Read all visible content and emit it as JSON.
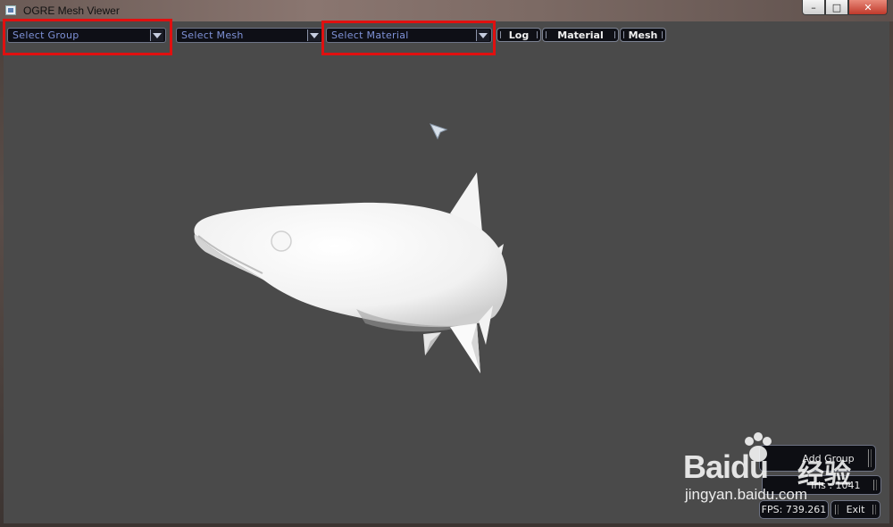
{
  "window": {
    "title": "OGRE Mesh Viewer",
    "controls": {
      "minimize": "–",
      "maximize": "□",
      "close": "✕"
    }
  },
  "toolbar": {
    "group_select": {
      "placeholder": "Select Group"
    },
    "mesh_select": {
      "placeholder": "Select Mesh"
    },
    "material_select": {
      "placeholder": "Select Material"
    },
    "tabs": [
      {
        "label": "Log"
      },
      {
        "label": "Material"
      },
      {
        "label": "Mesh"
      }
    ]
  },
  "panel": {
    "add_group_label": "Add Group",
    "tris_text": "Tris : 1041",
    "fps_text": "FPS: 739.261",
    "exit_label": "Exit"
  },
  "watermark": {
    "logo_text": "Baidu",
    "cn_text": "经验",
    "url_text": "jingyan.baidu.com"
  },
  "colors": {
    "highlight": "#e01010",
    "viewport_bg": "#4a4a4a",
    "combo_text": "#7f92d8"
  },
  "icons": {
    "combo_arrow": "chevron-down-icon",
    "app": "app-window-icon",
    "cursor": "cursor-icon"
  }
}
